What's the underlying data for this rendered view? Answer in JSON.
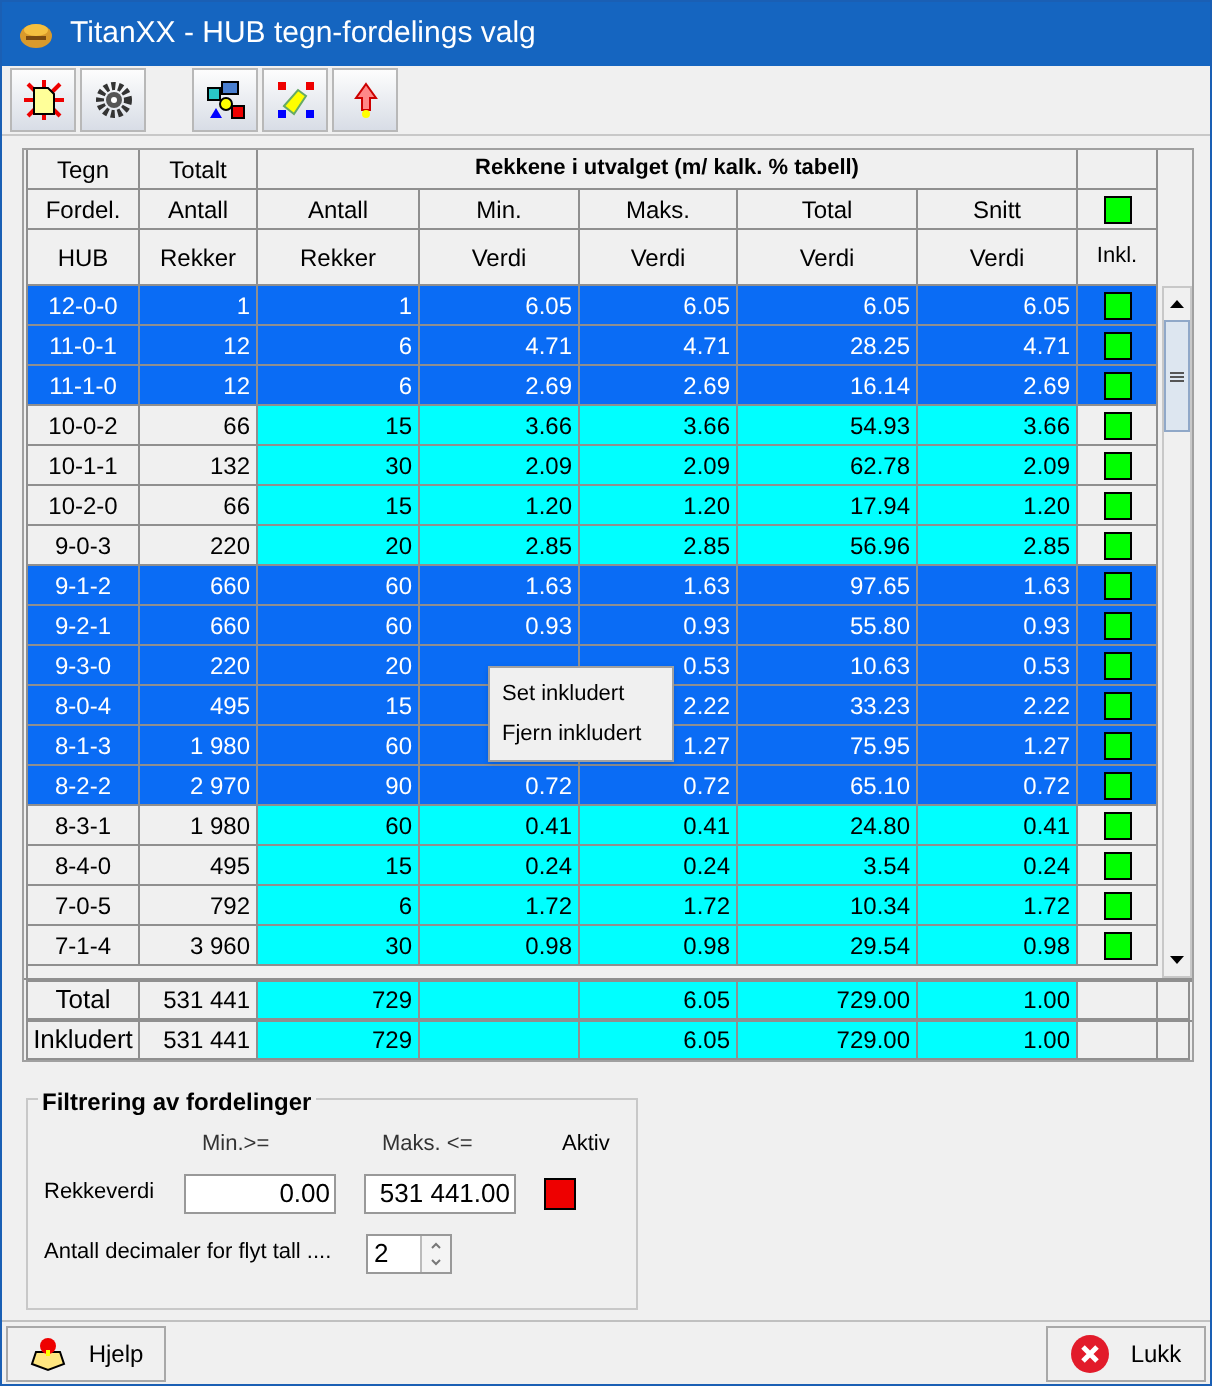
{
  "window": {
    "title": "TitanXX - HUB tegn-fordelings valg"
  },
  "table": {
    "columns": [
      {
        "top": "Tegn",
        "middle": "Fordel.",
        "bottom": "HUB"
      },
      {
        "top": "Totalt",
        "middle": "Antall",
        "bottom": "Rekker"
      }
    ],
    "group_title": "Rekkene i utvalget (m/ kalk. % tabell)",
    "group_columns": [
      {
        "middle": "Antall",
        "bottom": "Rekker"
      },
      {
        "middle": "Min.",
        "bottom": "Verdi"
      },
      {
        "middle": "Maks.",
        "bottom": "Verdi"
      },
      {
        "middle": "Total",
        "bottom": "Verdi"
      },
      {
        "middle": "Snitt",
        "bottom": "Verdi"
      }
    ],
    "include_column": {
      "label": "Inkl.",
      "header_included": true
    },
    "rows": [
      {
        "hub": "12-0-0",
        "totalt": "1",
        "antall": "1",
        "min": "6.05",
        "maks": "6.05",
        "total": "6.05",
        "snitt": "6.05",
        "included": true,
        "selected": true
      },
      {
        "hub": "11-0-1",
        "totalt": "12",
        "antall": "6",
        "min": "4.71",
        "maks": "4.71",
        "total": "28.25",
        "snitt": "4.71",
        "included": true,
        "selected": true
      },
      {
        "hub": "11-1-0",
        "totalt": "12",
        "antall": "6",
        "min": "2.69",
        "maks": "2.69",
        "total": "16.14",
        "snitt": "2.69",
        "included": true,
        "selected": true
      },
      {
        "hub": "10-0-2",
        "totalt": "66",
        "antall": "15",
        "min": "3.66",
        "maks": "3.66",
        "total": "54.93",
        "snitt": "3.66",
        "included": true,
        "selected": false
      },
      {
        "hub": "10-1-1",
        "totalt": "132",
        "antall": "30",
        "min": "2.09",
        "maks": "2.09",
        "total": "62.78",
        "snitt": "2.09",
        "included": true,
        "selected": false
      },
      {
        "hub": "10-2-0",
        "totalt": "66",
        "antall": "15",
        "min": "1.20",
        "maks": "1.20",
        "total": "17.94",
        "snitt": "1.20",
        "included": true,
        "selected": false
      },
      {
        "hub": "9-0-3",
        "totalt": "220",
        "antall": "20",
        "min": "2.85",
        "maks": "2.85",
        "total": "56.96",
        "snitt": "2.85",
        "included": true,
        "selected": false
      },
      {
        "hub": "9-1-2",
        "totalt": "660",
        "antall": "60",
        "min": "1.63",
        "maks": "1.63",
        "total": "97.65",
        "snitt": "1.63",
        "included": true,
        "selected": true
      },
      {
        "hub": "9-2-1",
        "totalt": "660",
        "antall": "60",
        "min": "0.93",
        "maks": "0.93",
        "total": "55.80",
        "snitt": "0.93",
        "included": true,
        "selected": true
      },
      {
        "hub": "9-3-0",
        "totalt": "220",
        "antall": "20",
        "maks": "0.53",
        "total": "10.63",
        "snitt": "0.53",
        "included": true,
        "selected": true
      },
      {
        "hub": "8-0-4",
        "totalt": "495",
        "antall": "15",
        "maks": "2.22",
        "total": "33.23",
        "snitt": "2.22",
        "included": true,
        "selected": true
      },
      {
        "hub": "8-1-3",
        "totalt": "1 980",
        "antall": "60",
        "maks": "1.27",
        "total": "75.95",
        "snitt": "1.27",
        "included": true,
        "selected": true
      },
      {
        "hub": "8-2-2",
        "totalt": "2 970",
        "antall": "90",
        "min": "0.72",
        "maks": "0.72",
        "total": "65.10",
        "snitt": "0.72",
        "included": true,
        "selected": true
      },
      {
        "hub": "8-3-1",
        "totalt": "1 980",
        "antall": "60",
        "min": "0.41",
        "maks": "0.41",
        "total": "24.80",
        "snitt": "0.41",
        "included": true,
        "selected": false
      },
      {
        "hub": "8-4-0",
        "totalt": "495",
        "antall": "15",
        "min": "0.24",
        "maks": "0.24",
        "total": "3.54",
        "snitt": "0.24",
        "included": true,
        "selected": false
      },
      {
        "hub": "7-0-5",
        "totalt": "792",
        "antall": "6",
        "min": "1.72",
        "maks": "1.72",
        "total": "10.34",
        "snitt": "1.72",
        "included": true,
        "selected": false
      },
      {
        "hub": "7-1-4",
        "totalt": "3 960",
        "antall": "30",
        "min": "0.98",
        "maks": "0.98",
        "total": "29.54",
        "snitt": "0.98",
        "included": true,
        "selected": false
      }
    ],
    "summary_rows": [
      {
        "label": "Total",
        "totalt": "531 441",
        "antall": "729",
        "maks": "6.05",
        "total": "729.00",
        "snitt": "1.00"
      },
      {
        "label": "Inkludert",
        "totalt": "531 441",
        "antall": "729",
        "maks": "6.05",
        "total": "729.00",
        "snitt": "1.00"
      }
    ]
  },
  "context_menu": {
    "items": [
      "Set inkludert",
      "Fjern inkludert"
    ]
  },
  "filter": {
    "title": "Filtrering av fordelinger",
    "min_label": "Min.>=",
    "max_label": "Maks. <=",
    "active_label": "Aktiv",
    "row_label": "Rekkeverdi",
    "min_value": "0.00",
    "max_value": "531 441.00",
    "active": false,
    "decimals_label": "Antall decimaler for flyt tall ....",
    "decimals_value": "2"
  },
  "buttons": [
    {
      "kind": "help",
      "label": "Hjelp"
    },
    {
      "kind": "close",
      "label": "Lukk"
    }
  ]
}
